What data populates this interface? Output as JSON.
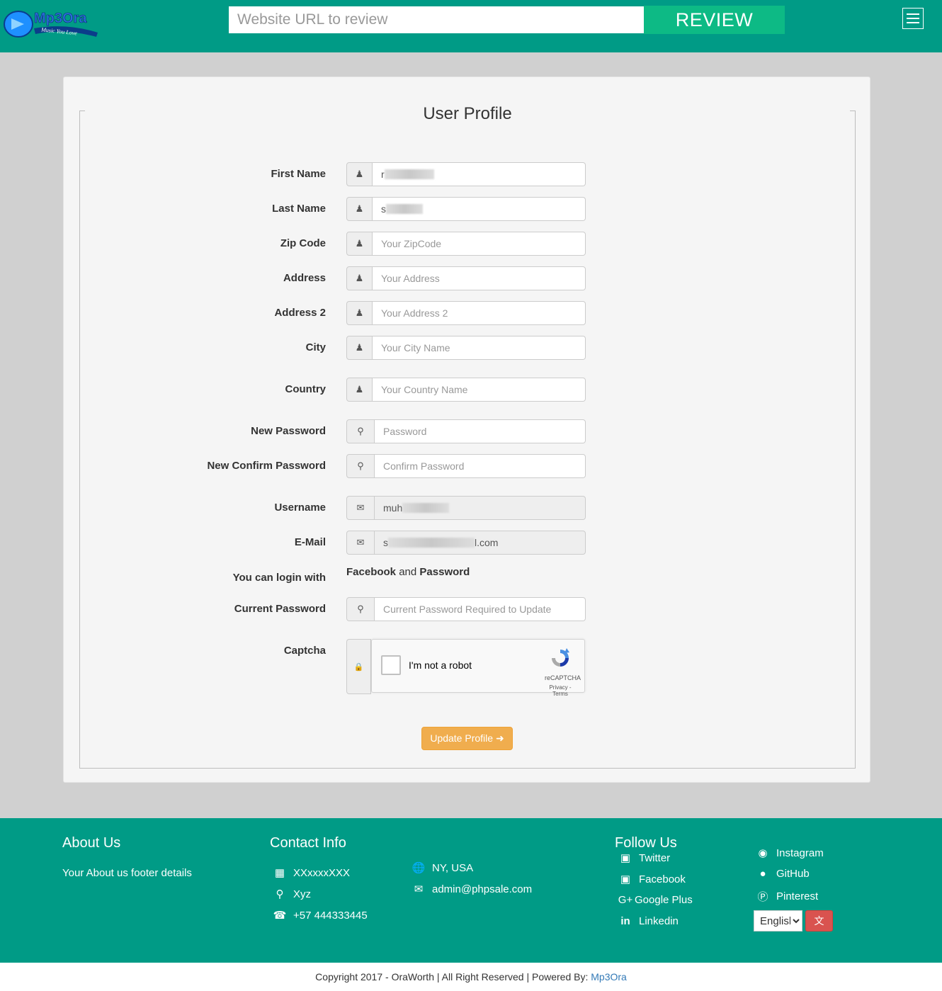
{
  "header": {
    "logo_text": "Mp3Ora",
    "logo_tagline": "Music You Love",
    "url_placeholder": "Website URL to review",
    "review_label": "REVIEW",
    "menu_icon": "hamburger-icon"
  },
  "form": {
    "title": "User Profile",
    "fields": {
      "first_name": {
        "label": "First Name",
        "value_prefix": "r"
      },
      "last_name": {
        "label": "Last Name",
        "value_prefix": "s"
      },
      "zip": {
        "label": "Zip Code",
        "placeholder": "Your ZipCode"
      },
      "address": {
        "label": "Address",
        "placeholder": "Your Address"
      },
      "address2": {
        "label": "Address 2",
        "placeholder": "Your Address 2"
      },
      "city": {
        "label": "City",
        "placeholder": "Your City Name"
      },
      "country": {
        "label": "Country",
        "placeholder": "Your Country Name"
      },
      "new_password": {
        "label": "New Password",
        "placeholder": "Password"
      },
      "confirm_password": {
        "label": "New Confirm Password",
        "placeholder": "Confirm Password"
      },
      "username": {
        "label": "Username",
        "value_prefix": "muh"
      },
      "email": {
        "label": "E-Mail",
        "value_prefix": "s",
        "value_suffix": "l.com"
      },
      "login_with": {
        "label": "You can login with",
        "provider1": "Facebook",
        "and": "and",
        "provider2": "Password"
      },
      "current_password": {
        "label": "Current Password",
        "placeholder": "Current Password Required to Update"
      },
      "captcha": {
        "label": "Captcha",
        "checkbox_text": "I'm not a robot",
        "brand": "reCAPTCHA",
        "terms": "Privacy - Terms"
      }
    },
    "submit_label": "Update Profile"
  },
  "footer": {
    "about": {
      "heading": "About Us",
      "text": "Your About us footer details"
    },
    "contact": {
      "heading": "Contact Info",
      "company": "XXxxxxXXX",
      "place": "Xyz",
      "phone": "+57 444333445",
      "location": "NY, USA",
      "email": "admin@phpsale.com"
    },
    "follow": {
      "heading": "Follow Us",
      "links": {
        "twitter": "Twitter",
        "facebook": "Facebook",
        "googleplus": "Google Plus",
        "linkedin": "Linkedin",
        "instagram": "Instagram",
        "github": "GitHub",
        "pinterest": "Pinterest"
      }
    },
    "language": "English"
  },
  "copyright": {
    "text": "Copyright 2017 - OraWorth | All Right Reserved | Powered By: ",
    "link": "Mp3Ora"
  },
  "colors": {
    "brand_teal": "#009b86",
    "review_green": "#0dba85",
    "update_orange": "#f0ad4e",
    "lang_red": "#d9534f"
  }
}
